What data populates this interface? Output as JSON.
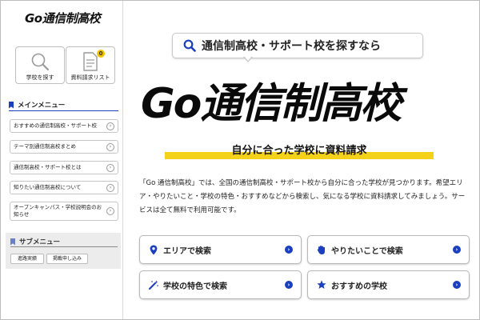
{
  "sidebar": {
    "logo": "Go通信制高校",
    "quick_links": [
      {
        "label": "学校を探す",
        "icon": "magnifier-icon"
      },
      {
        "label": "資料請求リスト",
        "icon": "document-icon",
        "badge": "0"
      }
    ],
    "main_menu": {
      "title": "メインメニュー",
      "items": [
        "おすすめの通信制高校・サポート校",
        "テーマ別通信制高校まとめ",
        "通信制高校・サポート校とは",
        "知りたい通信制高校について",
        "オープンキャンパス・学校説明会のお知らせ"
      ]
    },
    "sub_menu": {
      "title": "サブメニュー",
      "buttons": [
        "進路実績",
        "掲載申し込み"
      ]
    }
  },
  "main": {
    "search_prompt": "通信制高校・サポート校を探すなら",
    "hero_title": "Go通信制高校",
    "tagline": "自分に合った学校に資料請求",
    "description": "「Go 通信制高校」では、全国の通信制高校・サポート校から自分に合った学校が見つかります。希望エリア・やりたいこと・学校の特色・おすすめなどから検索し、気になる学校に資料請求してみましょう。サービスは全て無料で利用可能です。",
    "search_buttons": [
      {
        "label": "エリアで検索",
        "icon": "map-pin-icon"
      },
      {
        "label": "やりたいことで検索",
        "icon": "hand-icon"
      },
      {
        "label": "学校の特色で検索",
        "icon": "magic-wand-icon"
      },
      {
        "label": "おすすめの学校",
        "icon": "star-icon"
      }
    ]
  },
  "colors": {
    "accent_blue": "#1a3fbf",
    "highlight_yellow": "#f4d21a",
    "badge_yellow": "#f2c400"
  }
}
